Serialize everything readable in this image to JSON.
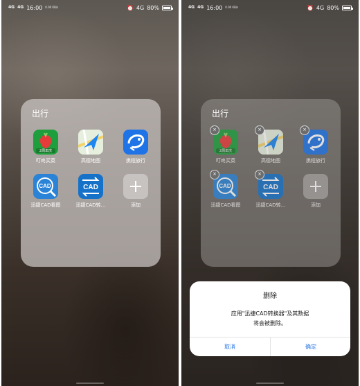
{
  "status_bar": {
    "signal_1": "4G",
    "signal_2": "4G",
    "time": "16:00",
    "speed": "0.00 KB/s",
    "network": "4G",
    "battery": "80%"
  },
  "folder": {
    "title": "出行",
    "apps": [
      {
        "label": "叮咚买菜",
        "icon": "dingdong-icon",
        "badge_text": "2周年庆"
      },
      {
        "label": "高德地图",
        "icon": "amap-icon"
      },
      {
        "label": "携程旅行",
        "icon": "ctrip-icon"
      },
      {
        "label": "迅捷CAD看图",
        "icon": "cad-viewer-icon"
      },
      {
        "label": "迅捷CAD转…",
        "icon": "cad-converter-icon"
      },
      {
        "label": "添加",
        "icon": "plus-icon"
      }
    ],
    "delete_glyph": "×"
  },
  "dialog": {
    "title": "删除",
    "message_line1": "应用\"迅捷CAD转换器\"及其数据",
    "message_line2": "将会被删除。",
    "cancel_label": "取消",
    "confirm_label": "确定"
  },
  "colors": {
    "accent": "#2f7ae5",
    "green_icon": "#1e9e3d",
    "ctrip_blue": "#1e73e6",
    "cad_blue": "#2a83d6"
  }
}
